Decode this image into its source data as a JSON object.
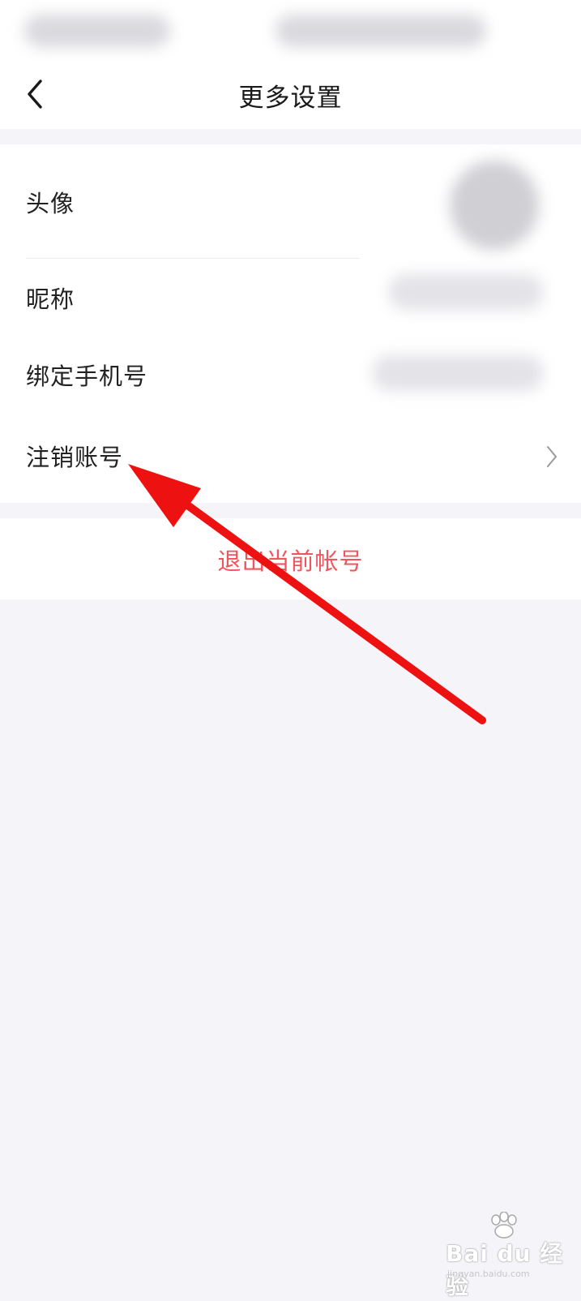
{
  "header": {
    "title": "更多设置"
  },
  "settings": {
    "items": [
      {
        "label": "头像"
      },
      {
        "label": "昵称"
      },
      {
        "label": "绑定手机号"
      },
      {
        "label": "注销账号"
      }
    ]
  },
  "logout": {
    "label": "退出当前帐号",
    "color": "#f0545c"
  },
  "icons": {
    "back": "chevron-left-icon",
    "row_arrow": "chevron-right-icon"
  },
  "watermark": {
    "brand": "Bai du 经验",
    "url": "jingyan.baidu.com"
  },
  "colors": {
    "background": "#f4f4f9",
    "card": "#ffffff",
    "annotation_arrow": "#ee1111"
  }
}
